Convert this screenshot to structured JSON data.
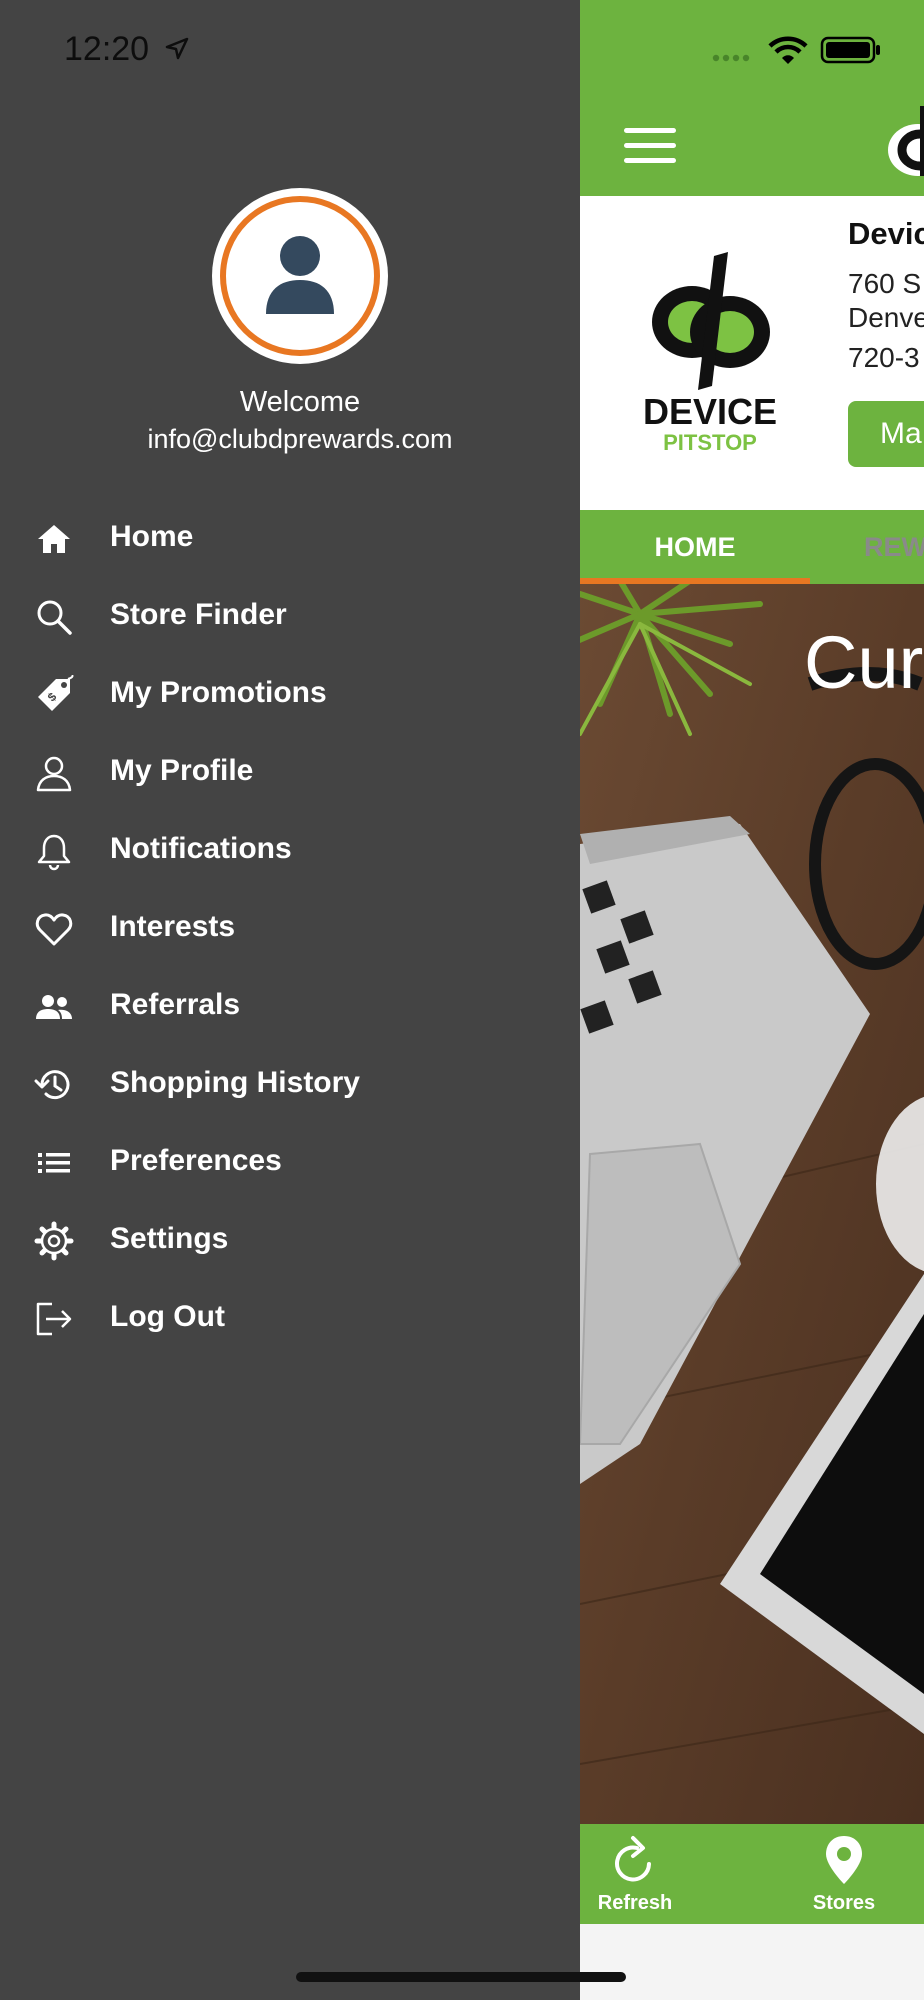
{
  "status_bar": {
    "time": "12:20"
  },
  "drawer": {
    "welcome": "Welcome",
    "email": "info@clubdprewards.com",
    "menu": [
      {
        "label": "Home",
        "icon": "home-icon"
      },
      {
        "label": "Store Finder",
        "icon": "search-icon"
      },
      {
        "label": "My Promotions",
        "icon": "tag-icon"
      },
      {
        "label": "My Profile",
        "icon": "user-icon"
      },
      {
        "label": "Notifications",
        "icon": "bell-icon"
      },
      {
        "label": "Interests",
        "icon": "heart-icon"
      },
      {
        "label": "Referrals",
        "icon": "group-icon"
      },
      {
        "label": "Shopping History",
        "icon": "history-icon"
      },
      {
        "label": "Preferences",
        "icon": "list-icon"
      },
      {
        "label": "Settings",
        "icon": "gear-icon"
      },
      {
        "label": "Log Out",
        "icon": "logout-icon"
      }
    ]
  },
  "store": {
    "name": "Devic",
    "street": "760 S",
    "city": "Denve",
    "phone": "720-3",
    "button_label": "Ma",
    "logo_word": "DEVICE",
    "logo_sub": "PITSTOP"
  },
  "tabs": {
    "home": "HOME",
    "rewards": "REW"
  },
  "hero": {
    "title": "Cur"
  },
  "bottom_nav": {
    "refresh": "Refresh",
    "stores": "Stores"
  },
  "colors": {
    "brand_green": "#6db33f",
    "accent_orange": "#e87722",
    "drawer_bg": "#444444",
    "avatar_navy": "#34495e"
  }
}
